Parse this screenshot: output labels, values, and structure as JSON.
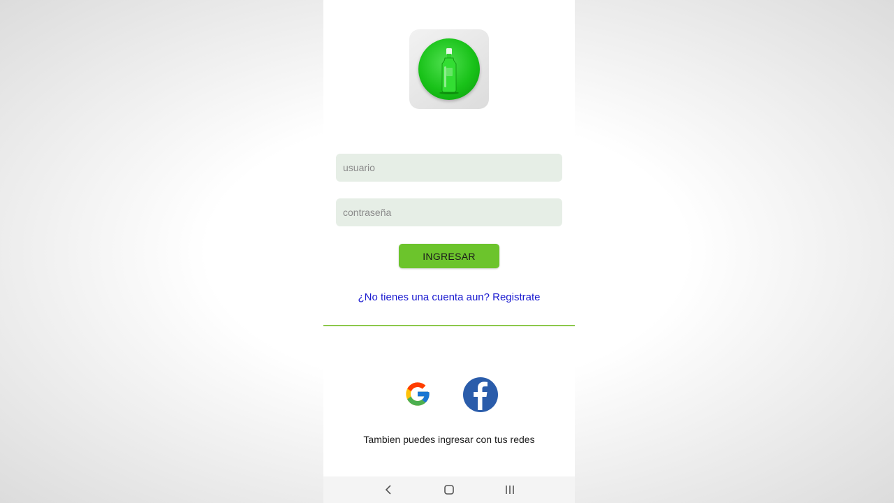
{
  "login": {
    "username_placeholder": "usuario",
    "password_placeholder": "contraseña",
    "submit_label": "INGRESAR",
    "register_link": "¿No tienes una cuenta aun? Registrate"
  },
  "social": {
    "caption": "Tambien puedes ingresar con tus redes",
    "providers": [
      "google",
      "facebook"
    ]
  },
  "icons": {
    "logo": "green-bottle-logo-icon",
    "google": "google-icon",
    "facebook": "facebook-icon",
    "back": "back-chevron-icon",
    "home": "home-icon",
    "recents": "recents-icon"
  },
  "colors": {
    "accent": "#6cc42c",
    "divider": "#8cc84b",
    "link": "#1a1ad0",
    "field_bg": "#e6eee6",
    "facebook": "#2a5caa"
  }
}
